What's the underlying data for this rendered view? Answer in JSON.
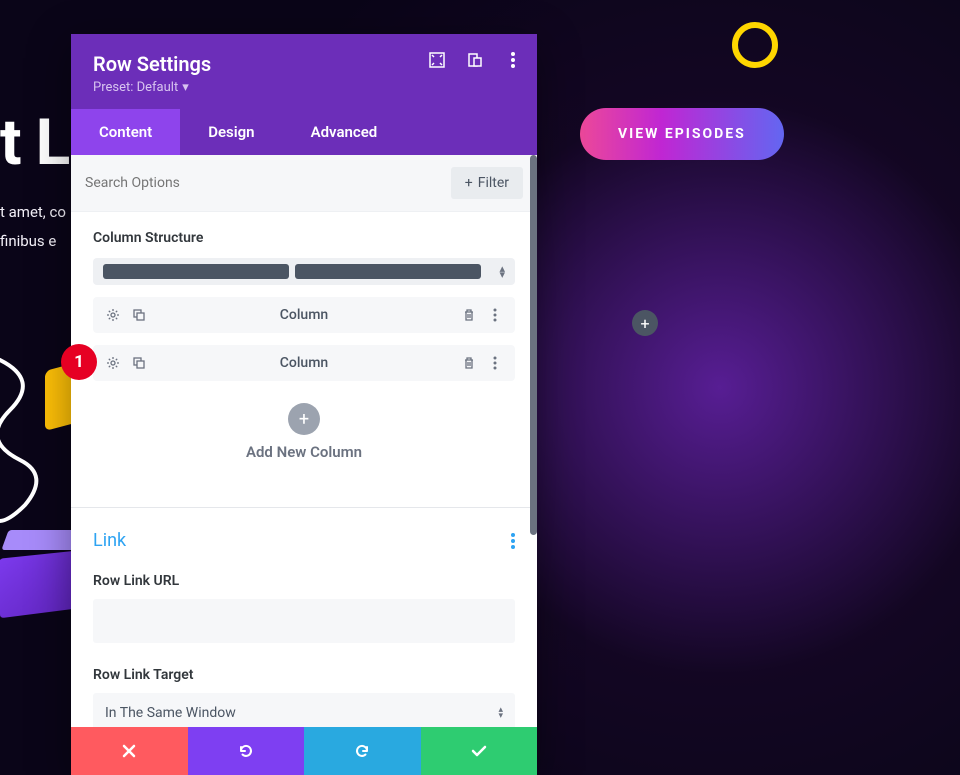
{
  "background": {
    "heading_fragment": "t L",
    "lorem_line1": "t amet, co",
    "lorem_line2": "finibus e",
    "view_episodes": "VIEW EPISODES",
    "add_icon": "+"
  },
  "modal": {
    "title": "Row Settings",
    "preset_label": "Preset: Default",
    "tabs": {
      "content": "Content",
      "design": "Design",
      "advanced": "Advanced"
    },
    "search": {
      "placeholder": "Search Options",
      "filter_label": "Filter"
    },
    "column_structure": {
      "label": "Column Structure"
    },
    "columns": [
      {
        "label": "Column"
      },
      {
        "label": "Column"
      }
    ],
    "add_new_column": "Add New Column",
    "link": {
      "title": "Link",
      "url_label": "Row Link URL",
      "url_value": "",
      "target_label": "Row Link Target",
      "target_value": "In The Same Window"
    }
  },
  "badge": {
    "number": "1"
  }
}
